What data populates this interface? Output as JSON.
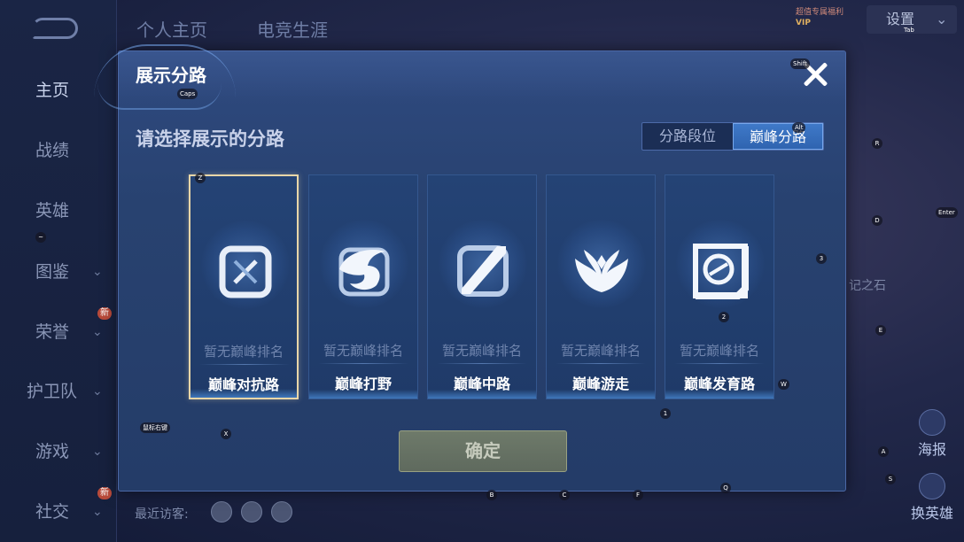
{
  "background": {
    "sidebar": {
      "items": [
        {
          "label": "主页",
          "active": true,
          "chevron": false,
          "badge": ""
        },
        {
          "label": "战绩",
          "active": false,
          "chevron": false,
          "badge": ""
        },
        {
          "label": "英雄",
          "active": false,
          "chevron": false,
          "badge": ""
        },
        {
          "label": "图鉴",
          "active": false,
          "chevron": true,
          "badge": ""
        },
        {
          "label": "荣誉",
          "active": false,
          "chevron": true,
          "badge": "新"
        },
        {
          "label": "护卫队",
          "active": false,
          "chevron": true,
          "badge": ""
        },
        {
          "label": "游戏",
          "active": false,
          "chevron": true,
          "badge": ""
        },
        {
          "label": "社交",
          "active": false,
          "chevron": true,
          "badge": "新"
        }
      ]
    },
    "top_tabs": [
      "个人主页",
      "电竞生涯"
    ],
    "top_right_badge_line1": "超值专属福利",
    "top_right_badge_line2": "VIP",
    "settings_label": "设置",
    "right_text": "记之石",
    "recent_visitors_label": "最近访客:",
    "right_actions": [
      "海报",
      "换英雄"
    ]
  },
  "modal": {
    "title": "展示分路",
    "subtitle": "请选择展示的分路",
    "toggle": [
      {
        "label": "分路段位",
        "active": false
      },
      {
        "label": "巅峰分路",
        "active": true
      }
    ],
    "lanes": [
      {
        "name": "巅峰对抗路",
        "rank": "暂无巅峰排名",
        "icon": "sword-shield-icon",
        "selected": true
      },
      {
        "name": "巅峰打野",
        "rank": "暂无巅峰排名",
        "icon": "dragon-icon",
        "selected": false
      },
      {
        "name": "巅峰中路",
        "rank": "暂无巅峰排名",
        "icon": "slash-icon",
        "selected": false
      },
      {
        "name": "巅峰游走",
        "rank": "暂无巅峰排名",
        "icon": "wings-icon",
        "selected": false
      },
      {
        "name": "巅峰发育路",
        "rank": "暂无巅峰排名",
        "icon": "arrow-ring-icon",
        "selected": false
      }
    ],
    "confirm_label": "确定"
  },
  "key_hints": [
    "Caps",
    "Shift",
    "Alt",
    "Tab",
    "R",
    "D",
    "Enter",
    "3",
    "2",
    "E",
    "W",
    "1",
    "Z",
    "X",
    "A",
    "S",
    "B",
    "C",
    "F",
    "Q",
    "鼠标右键",
    "~"
  ]
}
